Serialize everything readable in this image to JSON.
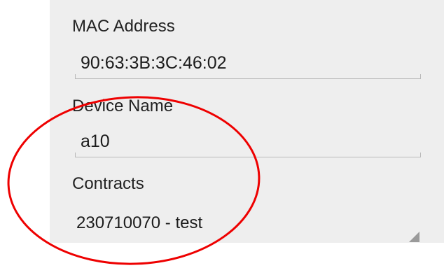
{
  "form": {
    "mac": {
      "label": "MAC Address",
      "value": "90:63:3B:3C:46:02"
    },
    "device": {
      "label": "Device Name",
      "value": "a10"
    },
    "contracts": {
      "label": "Contracts",
      "selected": "230710070 - test"
    }
  },
  "colors": {
    "panel_background": "#eeeeee",
    "annotation_circle": "#ee0000",
    "field_underline": "#b8b8b8"
  },
  "icons": {
    "contracts_dropdown": "dropdown-corner-triangle-icon"
  }
}
